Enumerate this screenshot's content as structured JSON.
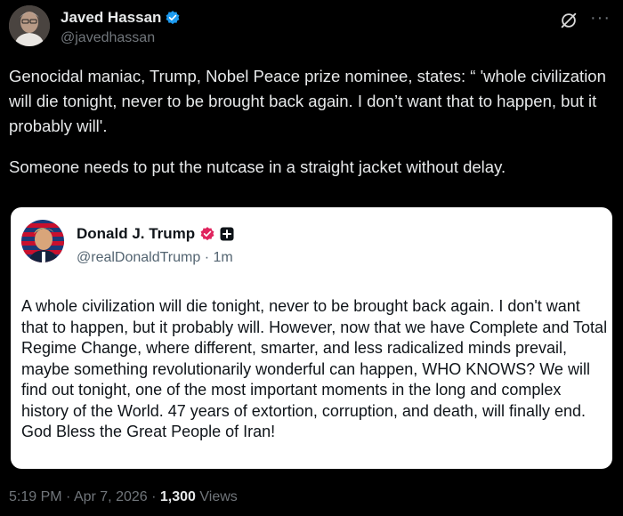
{
  "author": {
    "display_name": "Javed Hassan",
    "handle": "@javedhassan",
    "avatar_icon": "person-photo",
    "verified_icon": "verified-badge-icon",
    "accent_color": "#1d9bf0"
  },
  "header_actions": {
    "grok_icon": "grok-icon",
    "more_label": "···"
  },
  "tweet": {
    "paragraph_1": "Genocidal maniac, Trump, Nobel Peace prize nominee, states: “ 'whole civilization will die tonight, never to be brought back again. I don’t want that to happen, but it probably will'.",
    "paragraph_2": "Someone needs to put the nutcase in a straight jacket without delay."
  },
  "quoted_post": {
    "display_name": "Donald J. Trump",
    "handle": "@realDonaldTrump",
    "separator": "·",
    "time_ago": "1m",
    "badge_color": "#e0245e",
    "text": "A whole civilization will die tonight, never to be brought back again. I don't want that to happen, but it probably will. However, now that we have Complete and Total Regime Change, where different, smarter, and less radicalized minds prevail, maybe something revolutionarily wonderful can happen, WHO KNOWS? We will find out tonight, one of the most important moments in the long and complex history of the World. 47 years of extortion, corruption, and death, will finally end. God Bless the Great People of Iran!"
  },
  "meta": {
    "time": "5:19 PM",
    "separator_1": "·",
    "date": "Apr 7, 2026",
    "separator_2": "·",
    "views_count": "1,300",
    "views_label": "Views"
  }
}
